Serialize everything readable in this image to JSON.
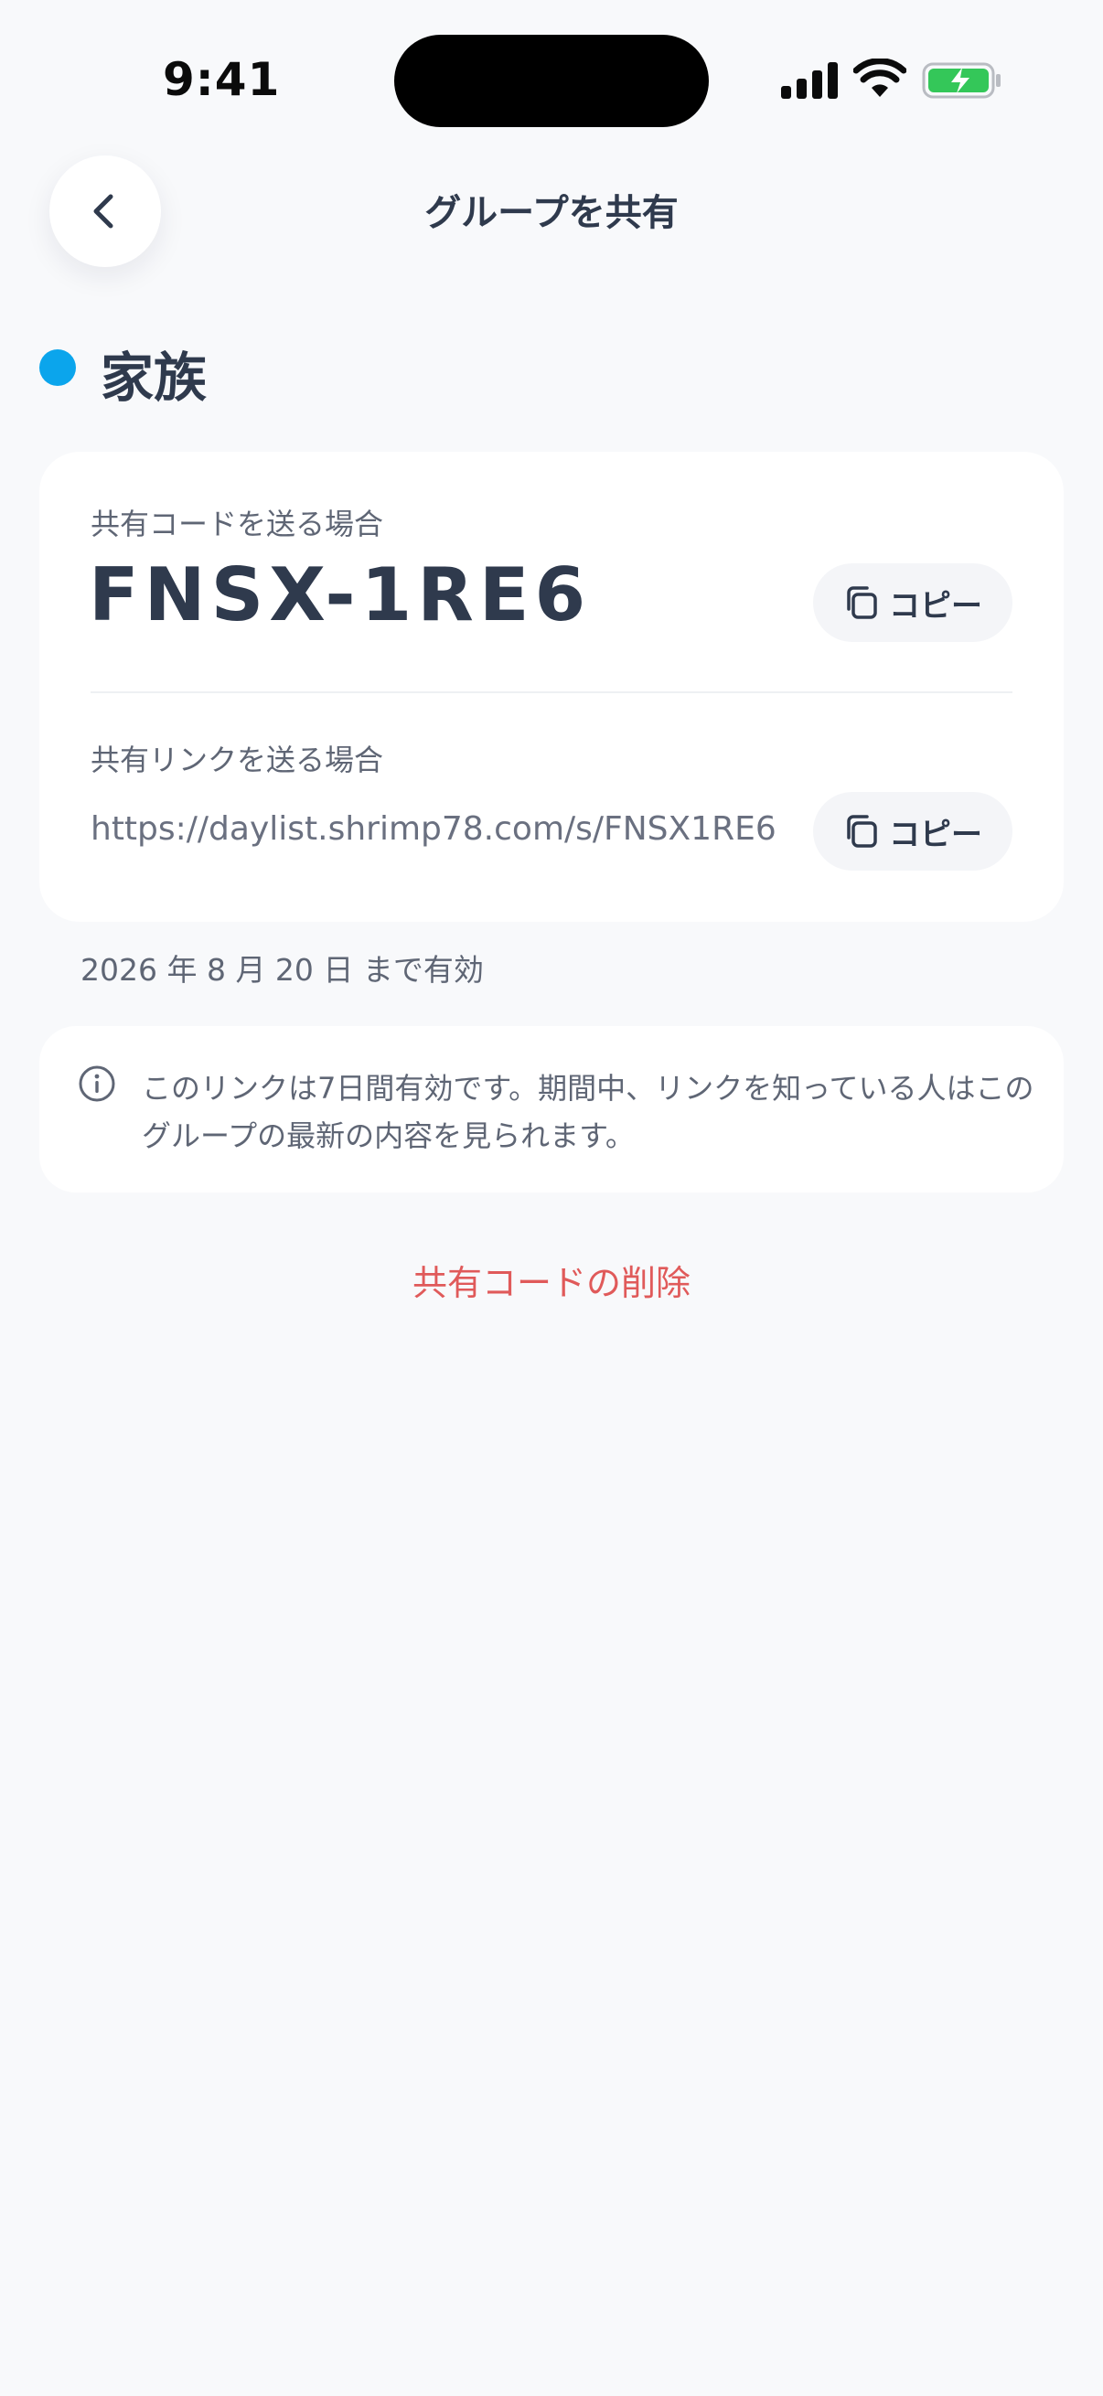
{
  "status_bar": {
    "time": "9:41"
  },
  "nav": {
    "back_icon": "chevron-left-icon",
    "title": "グループを共有"
  },
  "group": {
    "name": "家族",
    "dot_color": "#0ba5ec"
  },
  "share_card": {
    "code_label": "共有コードを送る場合",
    "code": "FNSX-1RE6",
    "copy_label": "コピー",
    "link_label": "共有リンクを送る場合",
    "link": "https://daylist.shrimp78.com/s/FNSX1RE6",
    "copy_icon": "copy-icon"
  },
  "expiry": "2026 年 8 月 20 日 まで有効",
  "info": {
    "icon": "info-icon",
    "text": "このリンクは7日間有効です。期間中、リンクを知っている人はこのグループの最新の内容を見られます。"
  },
  "delete_label": "共有コードの削除",
  "colors": {
    "background": "#f8f9fb",
    "text_primary": "#2f3a4d",
    "danger": "#e05a5a",
    "battery": "#34c759"
  }
}
